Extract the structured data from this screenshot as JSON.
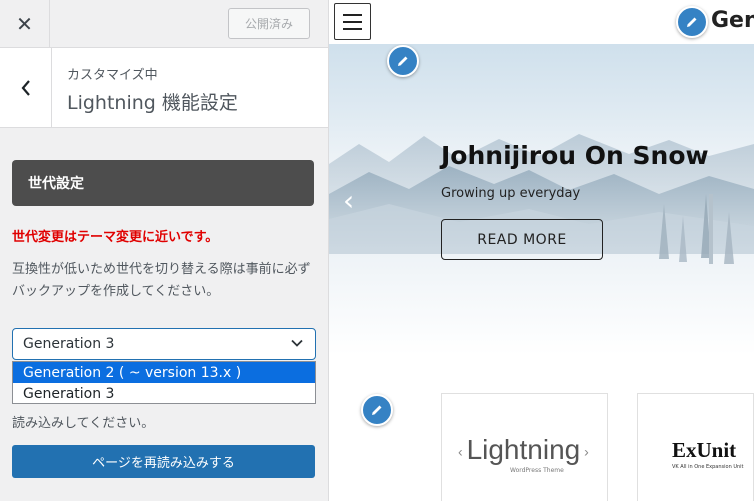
{
  "customizer": {
    "close_icon": "close-icon",
    "publish_label": "公開済み",
    "breadcrumb": "カスタマイズ中",
    "section_title": "Lightning 機能設定",
    "generation_heading": "世代設定",
    "warning": "世代変更はテーマ変更に近いです。",
    "description": "互換性が低いため世代を切り替える際は事前に必ずバックアップを作成してください。",
    "generation_select": {
      "value": "Generation 3",
      "options": [
        "Generation 2 ( ~ version 13.x )",
        "Generation 3"
      ],
      "highlighted_option": "Generation 2 ( ~ version 13.x )"
    },
    "reload_hint": "読み込みしてください。",
    "reload_button": "ページを再読み込みする"
  },
  "preview": {
    "site_title": "Gen",
    "slide": {
      "title": "Johnijirou On Snow",
      "subtitle": "Growing up everyday",
      "button": "READ MORE"
    },
    "cards": {
      "lightning": {
        "logo_text": "Lightning",
        "tagline": "WordPress Theme"
      },
      "exunit": {
        "logo_text": "ExUnit",
        "tagline": "VK All in One Expansion Unit"
      }
    }
  },
  "colors": {
    "accent_blue": "#2271b1",
    "warning_red": "#e00000",
    "heading_gray": "#4d4d4d",
    "edit_pin_blue": "#3582c4",
    "dropdown_highlight": "#0b6ee0"
  }
}
